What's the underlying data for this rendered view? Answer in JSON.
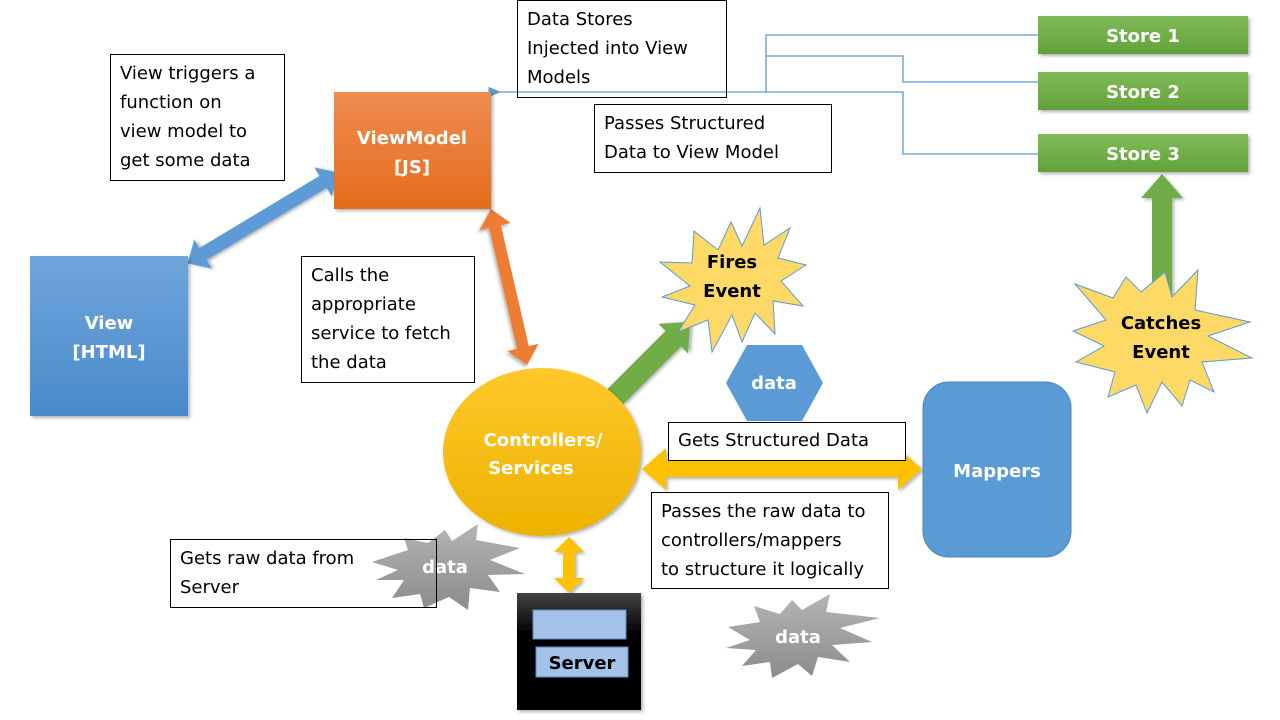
{
  "nodes": {
    "viewmodel": {
      "line1": "ViewModel",
      "line2": "[JS]"
    },
    "view": {
      "line1": "View",
      "line2": "[HTML]"
    },
    "controllers": {
      "line1": "Controllers/",
      "line2": "Services"
    },
    "mappers": {
      "label": "Mappers"
    },
    "server": {
      "label": "Server"
    },
    "stores": [
      {
        "label": "Store 1"
      },
      {
        "label": "Store 2"
      },
      {
        "label": "Store 3"
      }
    ],
    "fires_event": {
      "line1": "Fires",
      "line2": "Event"
    },
    "catches_event": {
      "line1": "Catches",
      "line2": "Event"
    },
    "data_hexagon": {
      "label": "data"
    },
    "data_burst_left": {
      "label": "data"
    },
    "data_burst_bottom": {
      "label": "data"
    }
  },
  "notes": {
    "view_triggers": "View triggers a\nfunction on\nview model to\nget some data",
    "data_stores_injected": "Data Stores\nInjected into View\nModels",
    "passes_structured": "Passes Structured\nData to View Model",
    "calls_service": "Calls the\nappropriate\nservice to fetch\nthe data",
    "gets_structured": "Gets Structured Data",
    "passes_raw": "Passes the raw data to\ncontrollers/mappers\nto structure it logically",
    "gets_raw": "Gets raw data from\nServer"
  },
  "colors": {
    "orange": "#ED7D31",
    "blue": "#5B9BD5",
    "green": "#70AD47",
    "gold": "#FFC000",
    "star": "#FFD966",
    "gray": "#A5A5A5",
    "connector": "#5B9BD5"
  }
}
